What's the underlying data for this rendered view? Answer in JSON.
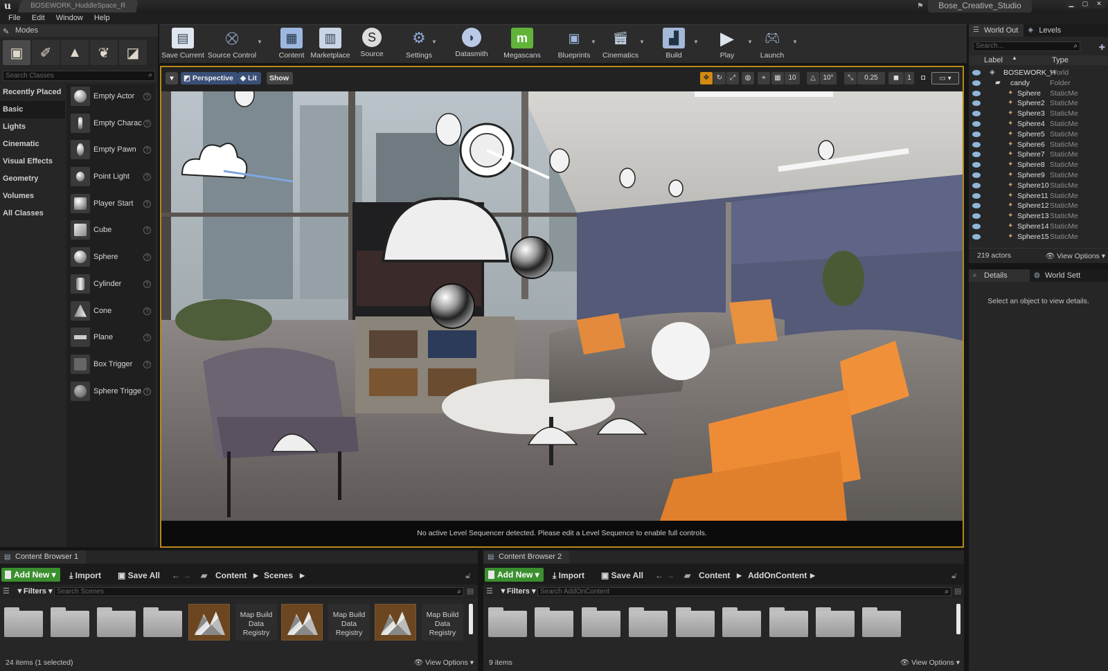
{
  "window": {
    "doc_tab": "BOSEWORK_HuddleSpace_R",
    "project": "Bose_Creative_Studio",
    "controls": [
      "▁",
      "▢",
      "✕"
    ]
  },
  "menu": [
    "File",
    "Edit",
    "Window",
    "Help"
  ],
  "modes": {
    "title": "Modes",
    "search_placeholder": "Search Classes",
    "categories": [
      "Recently Placed",
      "Basic",
      "Lights",
      "Cinematic",
      "Visual Effects",
      "Geometry",
      "Volumes",
      "All Classes"
    ],
    "selected_category": "Basic",
    "classes": [
      "Empty Actor",
      "Empty Charac",
      "Empty Pawn",
      "Point Light",
      "Player Start",
      "Cube",
      "Sphere",
      "Cylinder",
      "Cone",
      "Plane",
      "Box Trigger",
      "Sphere Trigge"
    ]
  },
  "toolbar": {
    "buttons": [
      "Save Current",
      "Source Control",
      "Content",
      "Marketplace",
      "Source",
      "Settings",
      "Datasmith",
      "Megascans",
      "Blueprints",
      "Cinematics",
      "Build",
      "Play",
      "Launch"
    ]
  },
  "viewport": {
    "perspective": "Perspective",
    "lit": "Lit",
    "show": "Show",
    "grid_snap": "10",
    "rot_snap": "10°",
    "scale_snap": "0.25",
    "camera_speed": "1",
    "status": "No active Level Sequencer detected. Please edit a Level Sequence to enable full controls."
  },
  "outliner": {
    "tab_world": "World Out",
    "tab_levels": "Levels",
    "search_placeholder": "Search...",
    "col_label": "Label",
    "col_type": "Type",
    "rows": [
      {
        "name": "BOSEWORK_H",
        "type": "World",
        "level": 0
      },
      {
        "name": "candy",
        "type": "Folder",
        "level": 1
      },
      {
        "name": "Sphere",
        "type": "StaticMe",
        "level": 2
      },
      {
        "name": "Sphere2",
        "type": "StaticMe",
        "level": 2
      },
      {
        "name": "Sphere3",
        "type": "StaticMe",
        "level": 2
      },
      {
        "name": "Sphere4",
        "type": "StaticMe",
        "level": 2
      },
      {
        "name": "Sphere5",
        "type": "StaticMe",
        "level": 2
      },
      {
        "name": "Sphere6",
        "type": "StaticMe",
        "level": 2
      },
      {
        "name": "Sphere7",
        "type": "StaticMe",
        "level": 2
      },
      {
        "name": "Sphere8",
        "type": "StaticMe",
        "level": 2
      },
      {
        "name": "Sphere9",
        "type": "StaticMe",
        "level": 2
      },
      {
        "name": "Sphere10",
        "type": "StaticMe",
        "level": 2
      },
      {
        "name": "Sphere11",
        "type": "StaticMe",
        "level": 2
      },
      {
        "name": "Sphere12",
        "type": "StaticMe",
        "level": 2
      },
      {
        "name": "Sphere13",
        "type": "StaticMe",
        "level": 2
      },
      {
        "name": "Sphere14",
        "type": "StaticMe",
        "level": 2
      },
      {
        "name": "Sphere15",
        "type": "StaticMe",
        "level": 2
      }
    ],
    "actor_count": "219 actors",
    "view_options": "View Options"
  },
  "details": {
    "tab_details": "Details",
    "tab_world": "World Sett",
    "message": "Select an object to view details."
  },
  "cb1": {
    "tab": "Content Browser 1",
    "add_new": "Add New",
    "import": "Import",
    "save_all": "Save All",
    "path": [
      "Content",
      "Scenes"
    ],
    "filters": "Filters",
    "search_placeholder": "Search Scenes",
    "mbdr_label": "Map Build Data Registry",
    "footer": "24 items (1 selected)",
    "view_options": "View Options"
  },
  "cb2": {
    "tab": "Content Browser 2",
    "add_new": "Add New",
    "import": "Import",
    "save_all": "Save All",
    "path": [
      "Content",
      "AddOnContent"
    ],
    "filters": "Filters",
    "search_placeholder": "Search AddOnContent",
    "footer": "9 items",
    "view_options": "View Options"
  },
  "colors": {
    "accent": "#b68a1a",
    "addnew": "#3a8f2e",
    "selection": "#d38a12"
  }
}
